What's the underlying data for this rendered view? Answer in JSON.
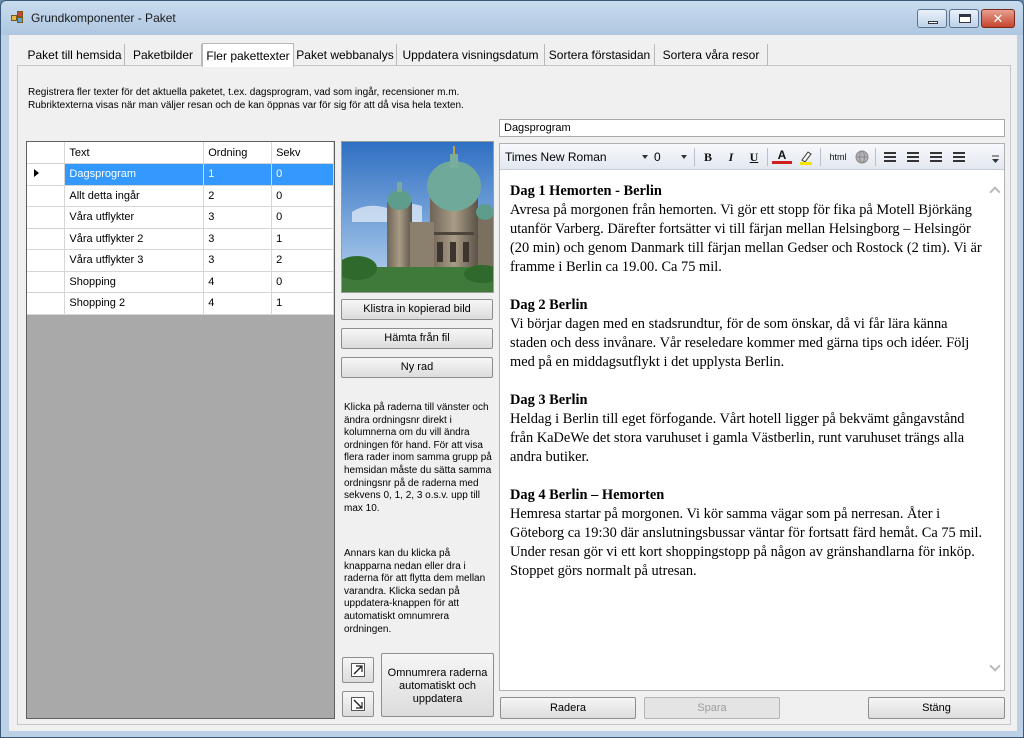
{
  "window": {
    "title": "Grundkomponenter - Paket"
  },
  "tabs": [
    {
      "label": "Paket till hemsida"
    },
    {
      "label": "Paketbilder"
    },
    {
      "label": "Fler pakettexter"
    },
    {
      "label": "Paket webbanalys"
    },
    {
      "label": "Uppdatera visningsdatum"
    },
    {
      "label": "Sortera förstasidan"
    },
    {
      "label": "Sortera våra resor"
    }
  ],
  "description": {
    "line1": "Registrera fler texter för det aktuella paketet, t.ex. dagsprogram, vad som ingår, recensioner m.m.",
    "line2": "Rubriktexterna visas när man väljer resan och de kan öppnas var för sig för att då visa hela texten."
  },
  "grid": {
    "columns": [
      "Text",
      "Ordning",
      "Sekv"
    ],
    "rows": [
      {
        "text": "Dagsprogram",
        "ordning": "1",
        "sekv": "0"
      },
      {
        "text": "Allt detta ingår",
        "ordning": "2",
        "sekv": "0"
      },
      {
        "text": "Våra utflykter",
        "ordning": "3",
        "sekv": "0"
      },
      {
        "text": "Våra utflykter 2",
        "ordning": "3",
        "sekv": "1"
      },
      {
        "text": "Våra utflykter 3",
        "ordning": "3",
        "sekv": "2"
      },
      {
        "text": "Shopping",
        "ordning": "4",
        "sekv": "0"
      },
      {
        "text": "Shopping 2",
        "ordning": "4",
        "sekv": "1"
      }
    ]
  },
  "image_buttons": {
    "paste": "Klistra in kopierad bild",
    "from_file": "Hämta från fil",
    "new_row": "Ny rad"
  },
  "help": {
    "text1": "Klicka på raderna till vänster och ändra ordningsnr direkt i kolumnerna om du vill ändra ordningen för hand. För att visa flera rader inom samma grupp på hemsidan måste du sätta samma ordningsnr på de raderna med sekvens 0, 1, 2, 3 o.s.v. upp till max 10.",
    "text2": "Annars kan du klicka på knapparna nedan eller dra i raderna för att flytta dem mellan varandra. Klicka sedan på uppdatera-knappen för att automatiskt omnumrera ordningen."
  },
  "renumber_button": "Omnumrera raderna automatiskt och uppdatera",
  "heading_field": {
    "value": "Dagsprogram"
  },
  "toolbar": {
    "font": "Times New Roman",
    "size": "0",
    "bold": "B",
    "italic": "I",
    "underline": "U",
    "font_color": "A",
    "html": "html"
  },
  "document": [
    {
      "heading": "Dag 1 Hemorten - Berlin",
      "body": "Avresa på morgonen från hemorten. Vi gör ett stopp för fika på Motell Björkäng utanför Varberg. Därefter fortsätter vi till färjan mellan Helsingborg – Helsingör (20 min) och genom Danmark till färjan mellan Gedser och Rostock (2 tim). Vi är framme i Berlin ca 19.00. Ca 75 mil."
    },
    {
      "heading": "Dag 2 Berlin",
      "body": "Vi börjar dagen med en stadsrundtur, för de som önskar, då vi får lära känna staden och dess invånare. Vår reseledare kommer med gärna tips och idéer. Följ med på en middagsutflykt i det upplysta Berlin."
    },
    {
      "heading": "Dag 3 Berlin",
      "body": "Heldag i Berlin till eget förfogande. Vårt hotell ligger på bekvämt gångavstånd från KaDeWe det stora varuhuset i gamla Västberlin, runt varuhuset trängs alla andra butiker."
    },
    {
      "heading": "Dag 4 Berlin – Hemorten",
      "body": "Hemresa startar på morgonen. Vi kör samma vägar som på nerresan. Åter i Göteborg ca 19:30 där anslutningsbussar väntar för fortsatt färd hemåt. Ca 75 mil. Under resan gör vi ett kort shoppingstopp på någon av gränshandlarna för inköp. Stoppet görs normalt på utresan."
    }
  ],
  "bottom_buttons": {
    "delete": "Radera",
    "save": "Spara",
    "close": "Stäng"
  },
  "colors": {
    "selection": "#3399ff",
    "accent_red": "#d02020",
    "highlight_yellow": "#f2e300"
  }
}
